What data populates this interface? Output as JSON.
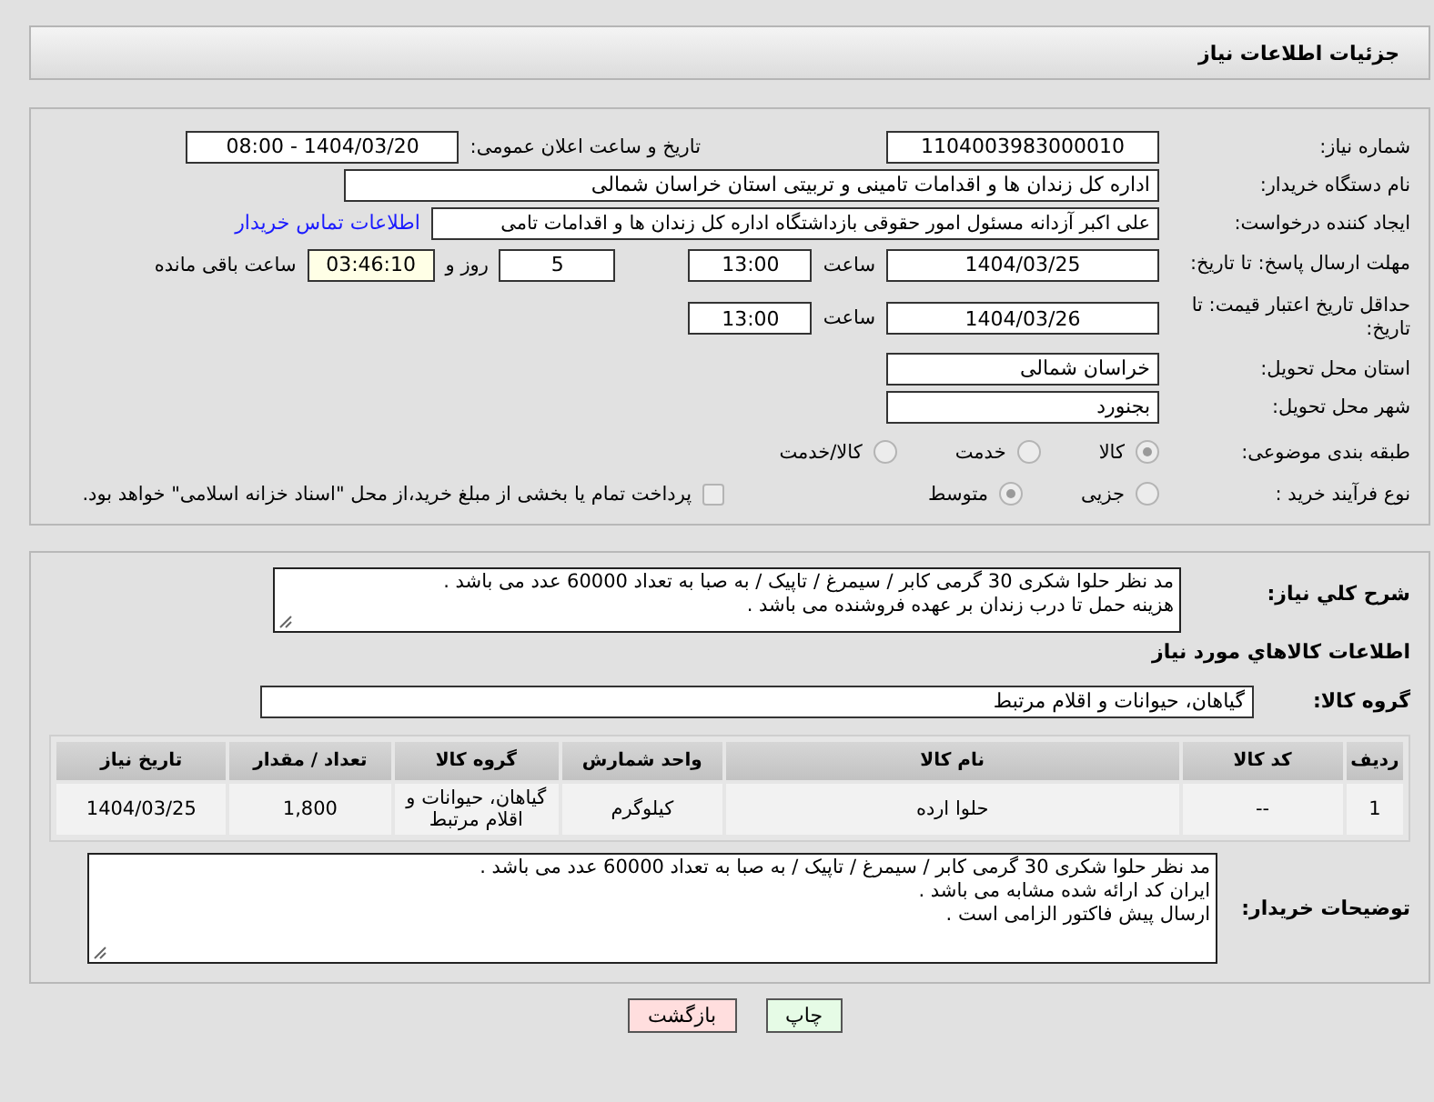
{
  "header": {
    "title": "جزئیات اطلاعات نیاز"
  },
  "need_number": {
    "label": "شماره نیاز:",
    "value": "1104003983000010"
  },
  "announce": {
    "label": "تاریخ و ساعت اعلان عمومی:",
    "value": "1404/03/20 - 08:00"
  },
  "buyer_org": {
    "label": "نام دستگاه خریدار:",
    "value": "اداره کل زندان ها و اقدامات تامینی و تربیتی استان خراسان شمالی"
  },
  "requester": {
    "label": "ایجاد کننده درخواست:",
    "value": "علی اکبر  آزدانه مسئول امور حقوقی بازداشتگاه اداره کل زندان ها و اقدامات تامی",
    "link": "اطلاعات تماس خریدار"
  },
  "reply_deadline": {
    "label": "مهلت ارسال پاسخ: تا تاریخ:",
    "date": "1404/03/25",
    "time_label": "ساعت",
    "time": "13:00",
    "days": "5",
    "days_label": "روز و",
    "remaining": "03:46:10",
    "remaining_label": "ساعت باقی مانده"
  },
  "price_validity": {
    "label": "حداقل تاریخ اعتبار قیمت: تا تاریخ:",
    "date": "1404/03/26",
    "time_label": "ساعت",
    "time": "13:00"
  },
  "province": {
    "label": "استان محل تحویل:",
    "value": "خراسان شمالی"
  },
  "city": {
    "label": "شهر محل تحویل:",
    "value": "بجنورد"
  },
  "category": {
    "label": "طبقه بندی موضوعی:",
    "options": [
      {
        "label": "کالا",
        "selected": true
      },
      {
        "label": "خدمت",
        "selected": false
      },
      {
        "label": "کالا/خدمت",
        "selected": false
      }
    ]
  },
  "process": {
    "label": "نوع فرآیند خرید :",
    "options": [
      {
        "label": "جزیی",
        "selected": false
      },
      {
        "label": "متوسط",
        "selected": true
      }
    ],
    "treasury": {
      "label": "پرداخت تمام یا بخشی از مبلغ خرید،از محل \"اسناد خزانه اسلامی\" خواهد بود.",
      "checked": false
    }
  },
  "description": {
    "label": "شرح کلي نياز:",
    "lines": [
      "مد نظر حلوا شکری 30 گرمی کابر / سیمرغ / تاپیک / به صبا به تعداد 60000 عدد می باشد .",
      "هزینه حمل تا درب زندان بر عهده فروشنده می باشد ."
    ]
  },
  "goods_heading": "اطلاعات کالاهاي مورد نياز",
  "goods_group": {
    "label": "گروه کالا:",
    "value": "گیاهان، حیوانات و اقلام مرتبط"
  },
  "table": {
    "columns": [
      "ردیف",
      "کد کالا",
      "نام کالا",
      "واحد شمارش",
      "گروه کالا",
      "تعداد / مقدار",
      "تاریخ نیاز"
    ],
    "rows": [
      {
        "cells": [
          "1",
          "--",
          "حلوا ارده",
          "کیلوگرم",
          "گیاهان، حیوانات و اقلام مرتبط",
          "1,800",
          "1404/03/25"
        ]
      }
    ]
  },
  "buyer_notes": {
    "label": "توضیحات خریدار:",
    "lines": [
      "مد نظر حلوا شکری 30 گرمی کابر / سیمرغ / تاپیک / به صبا به تعداد 60000 عدد می باشد .",
      "ایران کد ارائه شده مشابه می باشد .",
      "ارسال پیش فاکتور الزامی است ."
    ]
  },
  "buttons": [
    {
      "label": "چاپ",
      "kind": "print"
    },
    {
      "label": "بازگشت",
      "kind": "back"
    }
  ]
}
